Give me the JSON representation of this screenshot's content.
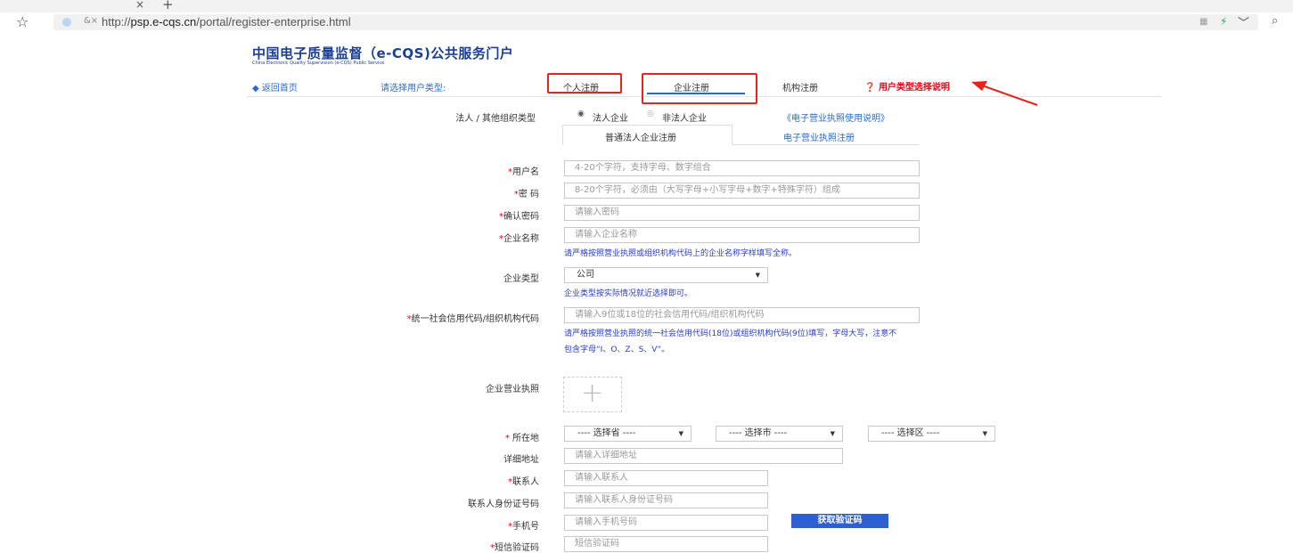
{
  "browser": {
    "url_prefix": "http://",
    "url_domain": "psp.e-cqs.cn",
    "url_path": "/portal/register-enterprise.html"
  },
  "header": {
    "title": "中国电子质量监督（e-CQS)公共服务门户",
    "subtitle": "China Electronic Quality Supervision (e-CQS) Public Service"
  },
  "nav": {
    "back": "返回首页",
    "choose_type": "请选择用户类型:",
    "personal": "个人注册",
    "enterprise": "企业注册",
    "institution": "机构注册",
    "type_help": "用户类型选择说明"
  },
  "org_type": {
    "label": "法人 / 其他组织类型",
    "option_legal": "法人企业",
    "option_nonlegal": "非法人企业",
    "license_link": "《电子营业执照使用说明》"
  },
  "subtabs": {
    "normal": "普通法人企业注册",
    "electronic": "电子营业执照注册"
  },
  "form": {
    "username_label": "用户名",
    "username_ph": "4-20个字符，支持字母、数字组合",
    "password_label": "密 码",
    "password_ph": "8-20个字符，必须由（大写字母+小写字母+数字+特殊字符）组成",
    "confirm_label": "确认密码",
    "confirm_ph": "请输入密码",
    "company_label": "企业名称",
    "company_ph": "请输入企业名称",
    "company_hint": "请严格按照营业执照或组织机构代码上的企业名称字样填写全称。",
    "ctype_label": "企业类型",
    "ctype_value": "公司",
    "ctype_hint": "企业类型按实际情况就近选择即可。",
    "credit_label": "统一社会信用代码/组织机构代码",
    "credit_ph": "请输入9位或18位的社会信用代码/组织机构代码",
    "credit_hint1": "请严格按照营业执照的统一社会信用代码(18位)或组织机构代码(9位)填写，字母大写，注意不",
    "credit_hint2": "包含字母“I、O、Z、S、V”。",
    "license_label": "企业营业执照",
    "location_label": "所在地",
    "province": "---- 选择省 ----",
    "city": "---- 选择市 ----",
    "district": "---- 选择区 ----",
    "address_label": "详细地址",
    "address_ph": "请输入详细地址",
    "contact_label": "联系人",
    "contact_ph": "请输入联系人",
    "idcard_label": "联系人身份证号码",
    "idcard_ph": "请输入联系人身份证号码",
    "phone_label": "手机号",
    "phone_ph": "请输入手机号码",
    "get_code": "获取验证码",
    "sms_label": "短信验证码",
    "sms_ph": "短信验证码"
  }
}
